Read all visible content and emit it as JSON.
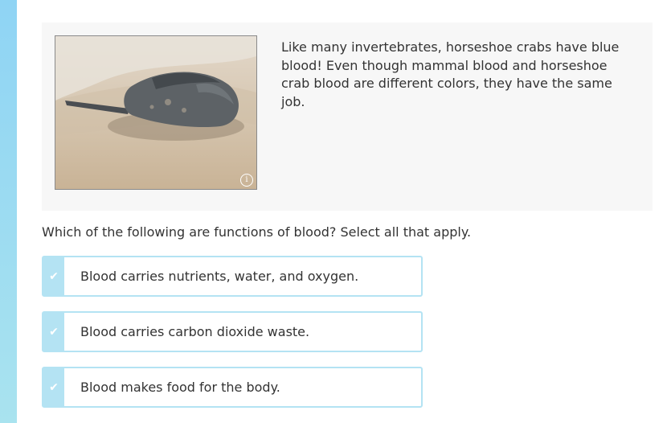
{
  "intro": {
    "text": "Like many invertebrates, horseshoe crabs have blue blood! Even though mammal blood and horseshoe crab blood are different colors, they have the same job.",
    "photo_icon": "info-icon",
    "photo_icon_glyph": "i"
  },
  "question": "Which of the following are functions of blood? Select all that apply.",
  "choices": [
    {
      "label": "Blood carries nutrients, water, and oxygen.",
      "icon": "checkmark-icon",
      "glyph": "✔"
    },
    {
      "label": "Blood carries carbon dioxide waste.",
      "icon": "checkmark-icon",
      "glyph": "✔"
    },
    {
      "label": "Blood makes food for the body.",
      "icon": "checkmark-icon",
      "glyph": "✔"
    }
  ],
  "colors": {
    "accent": "#b4e3f3",
    "rail": "#a9e3ef",
    "panel": "#f7f7f7",
    "text": "#333333"
  }
}
